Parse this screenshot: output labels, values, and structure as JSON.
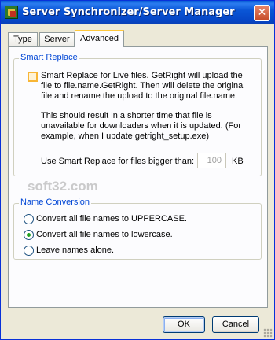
{
  "window": {
    "title": "Server Synchronizer/Server Manager",
    "close_glyph": "✕"
  },
  "tabs": [
    "Type",
    "Server",
    "Advanced"
  ],
  "smart_replace": {
    "group_title": "Smart Replace",
    "checkbox_label": [
      "Smart Replace for Live files.  GetRight will upload the",
      "file to file.name.GetRight.  Then will delete the original",
      "file and rename the upload to the original file.name."
    ],
    "checked": false,
    "description": [
      "This should result in a shorter time that file is",
      "unavailable for downloaders when it is updated.  (For",
      "example, when I update getright_setup.exe)"
    ],
    "size_label": "Use Smart Replace for files bigger than:",
    "size_value": "100",
    "size_unit": "KB"
  },
  "name_conversion": {
    "group_title": "Name Conversion",
    "options": [
      "Convert all file names to UPPERCASE.",
      "Convert all file names to lowercase.",
      "Leave names alone."
    ],
    "selected_index": 1
  },
  "buttons": {
    "ok": "OK",
    "cancel": "Cancel"
  },
  "watermark": "soft32.com",
  "colors": {
    "titlebar": "#0a56d6",
    "group_title": "#0046d5",
    "tab_highlight": "#ffc83c",
    "radio_dot": "#21a121"
  }
}
